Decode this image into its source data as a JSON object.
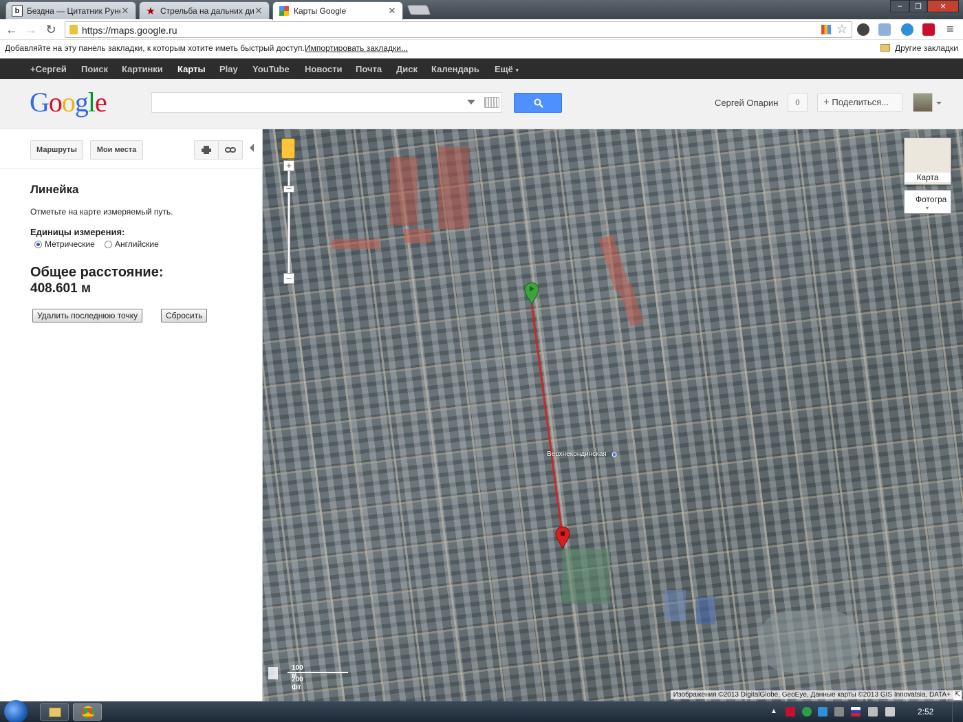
{
  "browser": {
    "tabs": [
      {
        "title": "Бездна — Цитатник Руне",
        "favicon": "b"
      },
      {
        "title": "Стрельба на дальних дис",
        "favicon": "★"
      },
      {
        "title": "Карты Google",
        "favicon": "maps"
      }
    ],
    "url": "https://maps.google.ru",
    "bookmarks_hint": "Добавляйте на эту панель закладки, к которым хотите иметь быстрый доступ.",
    "import_link": "Импортировать закладки...",
    "other_bookmarks": "Другие закладки",
    "colors": {
      "tabstrip": "#3b434b",
      "accent_red": "#d10000"
    }
  },
  "gbar": {
    "items": [
      "+Сергей",
      "Поиск",
      "Картинки",
      "Карты",
      "Play",
      "YouTube",
      "Новости",
      "Почта",
      "Диск",
      "Календарь",
      "Ещё"
    ],
    "active": "Карты"
  },
  "header": {
    "logo": "Google",
    "search_value": "",
    "user_name": "Сергей Опарин",
    "notifications": "0",
    "share_label": "Поделиться..."
  },
  "panel": {
    "routes_label": "Маршруты",
    "my_places_label": "Мои места",
    "ruler": {
      "title": "Линейка",
      "description": "Отметьте на карте измеряемый путь.",
      "units_label": "Единицы измерения:",
      "unit_metric": "Метрические",
      "unit_english": "Английские",
      "selected_unit": "metric",
      "total_label": "Общее расстояние:",
      "total_value": "408.601 м",
      "delete_last_label": "Удалить последнюю точку",
      "reset_label": "Сбросить"
    }
  },
  "map": {
    "type_map_label": "Карта",
    "type_photo_label": "Фотогра",
    "place_label": "Верхнекондинская",
    "scale_metric": "100 м",
    "scale_imperial": "200 фт",
    "attribution": "Изображения ©2013 DigitalGlobe, GeoEye, Данные карты ©2013 GIS Innovatsia, DATA+",
    "route_color": "#d62020",
    "start_marker_color": "#3da33d",
    "end_marker_color": "#d62020"
  },
  "taskbar": {
    "clock": "2:52"
  }
}
